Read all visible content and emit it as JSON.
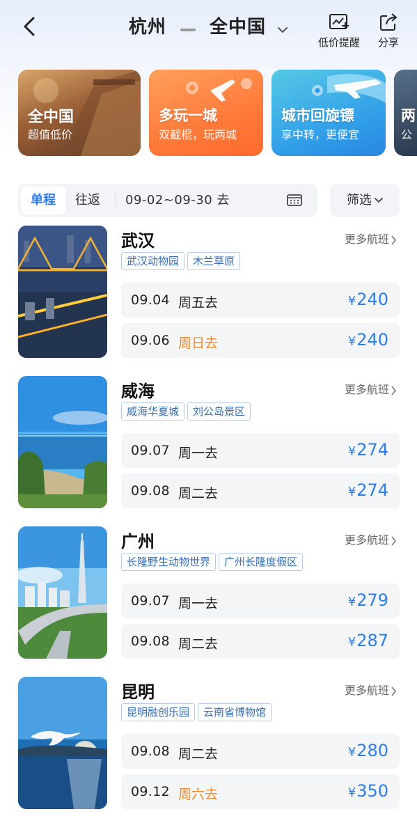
{
  "header": {
    "origin": "杭州",
    "destination": "全中国",
    "alert_label": "低价提醒",
    "share_label": "分享"
  },
  "banners": [
    {
      "title": "全中国",
      "subtitle": "超值低价"
    },
    {
      "title": "多玩一城",
      "subtitle": "双截棍，玩两城"
    },
    {
      "title": "城市回旋镖",
      "subtitle": "享中转，更便宜"
    },
    {
      "title": "两",
      "subtitle": "公"
    }
  ],
  "filters": {
    "tab_oneway": "单程",
    "tab_round": "往返",
    "date_range": "09-02~09-30 去",
    "filter_label": "筛选"
  },
  "currency_symbol": "¥",
  "more_flights_label": "更多航班",
  "destinations": [
    {
      "city": "武汉",
      "tags": [
        "武汉动物园",
        "木兰草原"
      ],
      "flights": [
        {
          "date": "09.04",
          "weekday": "周五去",
          "price": "240"
        },
        {
          "date": "09.06",
          "weekday": "周日去",
          "price": "240"
        }
      ]
    },
    {
      "city": "威海",
      "tags": [
        "威海华夏城",
        "刘公岛景区"
      ],
      "flights": [
        {
          "date": "09.07",
          "weekday": "周一去",
          "price": "274"
        },
        {
          "date": "09.08",
          "weekday": "周二去",
          "price": "274"
        }
      ]
    },
    {
      "city": "广州",
      "tags": [
        "长隆野生动物世界",
        "广州长隆度假区"
      ],
      "flights": [
        {
          "date": "09.07",
          "weekday": "周一去",
          "price": "279"
        },
        {
          "date": "09.08",
          "weekday": "周二去",
          "price": "287"
        }
      ]
    },
    {
      "city": "昆明",
      "tags": [
        "昆明融创乐园",
        "云南省博物馆"
      ],
      "flights": [
        {
          "date": "09.08",
          "weekday": "周二去",
          "price": "280"
        },
        {
          "date": "09.12",
          "weekday": "周六去",
          "price": "350"
        }
      ]
    }
  ],
  "colors": {
    "accent": "#2b7de9",
    "weekend": "#f08a24",
    "tag_text": "#3a6fb0"
  }
}
